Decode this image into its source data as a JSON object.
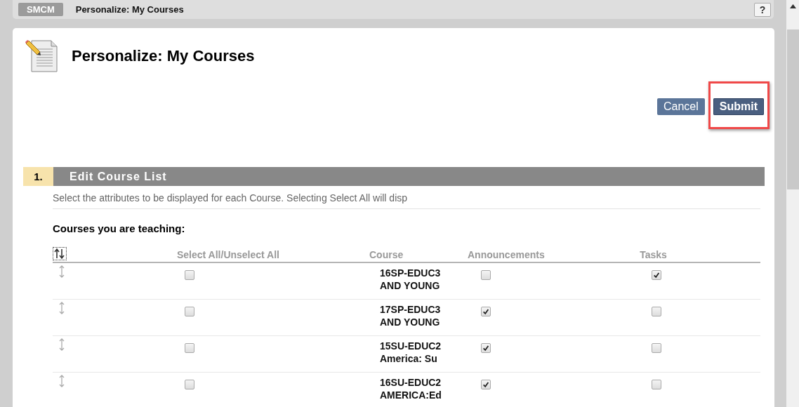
{
  "breadcrumb": {
    "badge": "SMCM",
    "title": "Personalize: My Courses",
    "help": "?"
  },
  "page_title": "Personalize: My Courses",
  "buttons": [
    {
      "label": "Cancel",
      "kind": "secondary",
      "highlighted": false
    },
    {
      "label": "Submit",
      "kind": "primary",
      "highlighted": true
    }
  ],
  "section": {
    "number": "1.",
    "title": "Edit Course List",
    "description": "Select the attributes to be displayed for each Course. Selecting Select All will disp",
    "subheading": "Courses you are teaching:"
  },
  "table": {
    "columns": [
      "Select All/Unselect All",
      "Course",
      "Announcements",
      "Tasks"
    ],
    "rows": [
      {
        "selected": false,
        "course": [
          "16SP-EDUC3",
          "AND YOUNG"
        ],
        "announcements": false,
        "tasks": true
      },
      {
        "selected": false,
        "course": [
          "17SP-EDUC3",
          "AND YOUNG"
        ],
        "announcements": true,
        "tasks": false
      },
      {
        "selected": false,
        "course": [
          "15SU-EDUC2",
          "America: Su"
        ],
        "announcements": true,
        "tasks": false
      },
      {
        "selected": false,
        "course": [
          "16SU-EDUC2",
          "AMERICA:Ed"
        ],
        "announcements": true,
        "tasks": false
      }
    ]
  }
}
